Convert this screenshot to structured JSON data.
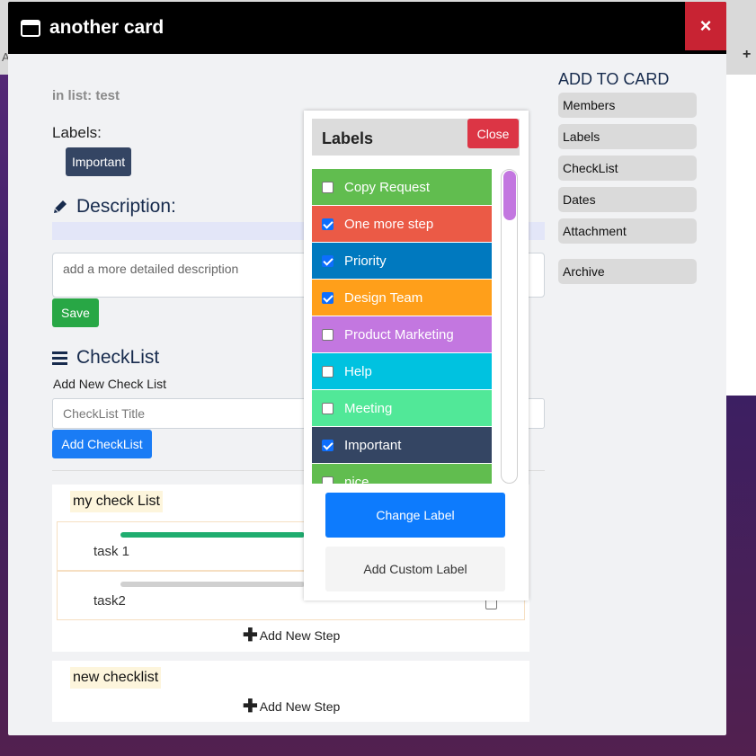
{
  "background": {
    "corner_letter": "A",
    "plus": "+"
  },
  "modal": {
    "title": "another card",
    "close_glyph": "×",
    "in_list": "in list: test",
    "labels_heading": "Labels:",
    "selected_label": "Important",
    "description": {
      "heading": "Description:",
      "placeholder": "add a more detailed description",
      "save": "Save"
    },
    "checklist": {
      "heading": "CheckList",
      "add_new": "Add New Check List",
      "placeholder": "CheckList Title",
      "add_button": "Add CheckList"
    },
    "checklists": [
      {
        "title": "my check List",
        "tasks": [
          {
            "name": "task 1",
            "progress": 1.0,
            "progress_color": "#1fad6f"
          },
          {
            "name": "task2",
            "progress": 0.0,
            "progress_color": "#d0d0d0"
          }
        ],
        "add_step": "Add New Step"
      },
      {
        "title": "new checklist",
        "tasks": [],
        "add_step": "Add New Step"
      }
    ],
    "add_to_card": {
      "heading": "ADD TO CARD",
      "items": [
        "Members",
        "Labels",
        "CheckList",
        "Dates",
        "Attachment",
        "Archive"
      ]
    }
  },
  "labels_popup": {
    "title": "Labels",
    "close": "Close",
    "labels": [
      {
        "name": "Copy Request",
        "color": "#61bd4f",
        "checked": false
      },
      {
        "name": "One more step",
        "color": "#eb5a46",
        "checked": true
      },
      {
        "name": "Priority",
        "color": "#0079bf",
        "checked": true
      },
      {
        "name": "Design Team",
        "color": "#ff9f1a",
        "checked": true
      },
      {
        "name": "Product Marketing",
        "color": "#c377e0",
        "checked": false
      },
      {
        "name": "Help",
        "color": "#00c2e0",
        "checked": false
      },
      {
        "name": "Meeting",
        "color": "#51e898",
        "checked": false
      },
      {
        "name": "Important",
        "color": "#344563",
        "checked": true
      },
      {
        "name": "nice",
        "color": "#61bd4f",
        "checked": false
      }
    ],
    "change_button": "Change Label",
    "custom_button": "Add Custom Label"
  }
}
